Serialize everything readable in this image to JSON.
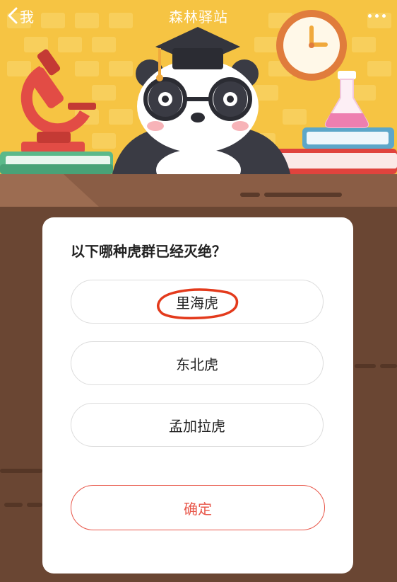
{
  "header": {
    "back_label": "我",
    "title": "森林驿站"
  },
  "quiz": {
    "question": "以下哪种虎群已经灭绝？",
    "options": [
      {
        "label": "里海虎",
        "circled": true
      },
      {
        "label": "东北虎",
        "circled": false
      },
      {
        "label": "孟加拉虎",
        "circled": false
      }
    ],
    "confirm_label": "确定"
  },
  "colors": {
    "wall_yellow": "#f6c443",
    "desk_brown": "#6a4633",
    "accent_red": "#e8574a",
    "annotation_red": "#e33a1c"
  },
  "icons": [
    "back-chevron-icon",
    "more-dots-icon",
    "microscope-icon",
    "clock-icon",
    "flask-icon",
    "panda-mascot",
    "graduation-cap-icon",
    "book-stack-icon"
  ]
}
